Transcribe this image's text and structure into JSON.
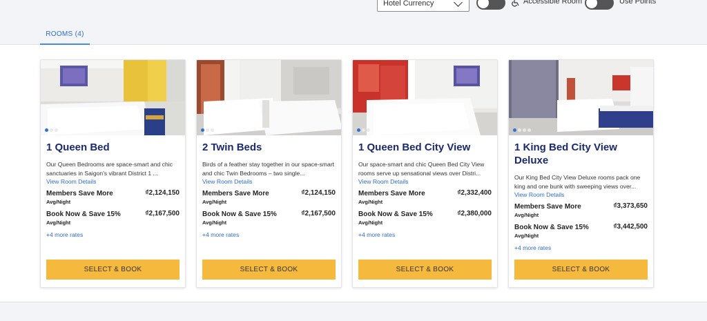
{
  "filters": {
    "currency_value": "Hotel Currency",
    "accessible_label": "Accessible Room",
    "points_label": "Use Points"
  },
  "tabs": [
    {
      "label": "ROOMS (4)"
    }
  ],
  "rooms": [
    {
      "title": "1 Queen Bed",
      "description": "Our Queen Bedrooms are space-smart and chic sanctuaries in Saigon's vibrant District 1 ...",
      "details_link": "View Room Details",
      "rates": [
        {
          "name": "Members Save More",
          "sub": "Avg/Night",
          "price": "₫2,124,150"
        },
        {
          "name": "Book Now & Save 15%",
          "sub": "Avg/Night",
          "price": "₫2,167,500"
        }
      ],
      "more_rates": "+4 more rates",
      "button": "SELECT & BOOK",
      "photo_dots": 3
    },
    {
      "title": "2 Twin Beds",
      "description": "Birds of a feather stay together in our space-smart and chic Twin Bedrooms – two single...",
      "details_link": "View Room Details",
      "rates": [
        {
          "name": "Members Save More",
          "sub": "Avg/Night",
          "price": "₫2,124,150"
        },
        {
          "name": "Book Now & Save 15%",
          "sub": "Avg/Night",
          "price": "₫2,167,500"
        }
      ],
      "more_rates": "+4 more rates",
      "button": "SELECT & BOOK",
      "photo_dots": 3
    },
    {
      "title": "1 Queen Bed City View",
      "description": "Our space-smart and chic Queen Bed City View rooms serve up sensational views over Distri...",
      "details_link": "View Room Details",
      "rates": [
        {
          "name": "Members Save More",
          "sub": "Avg/Night",
          "price": "₫2,332,400"
        },
        {
          "name": "Book Now & Save 15%",
          "sub": "Avg/Night",
          "price": "₫2,380,000"
        }
      ],
      "more_rates": "+4 more rates",
      "button": "SELECT & BOOK",
      "photo_dots": 3
    },
    {
      "title": "1 King Bed City View Deluxe",
      "description": "Our King Bed City View Deluxe rooms pack one king and one bunk with sweeping views over...",
      "details_link": "View Room Details",
      "rates": [
        {
          "name": "Members Save More",
          "sub": "Avg/Night",
          "price": "₫3,373,650"
        },
        {
          "name": "Book Now & Save 15%",
          "sub": "Avg/Night",
          "price": "₫3,442,500"
        }
      ],
      "more_rates": "+4 more rates",
      "button": "SELECT & BOOK",
      "photo_dots": 4
    }
  ],
  "colors": {
    "accent_blue": "#2e6bd6",
    "title_navy": "#1a2a6c",
    "button_yellow": "#f5b93d"
  }
}
